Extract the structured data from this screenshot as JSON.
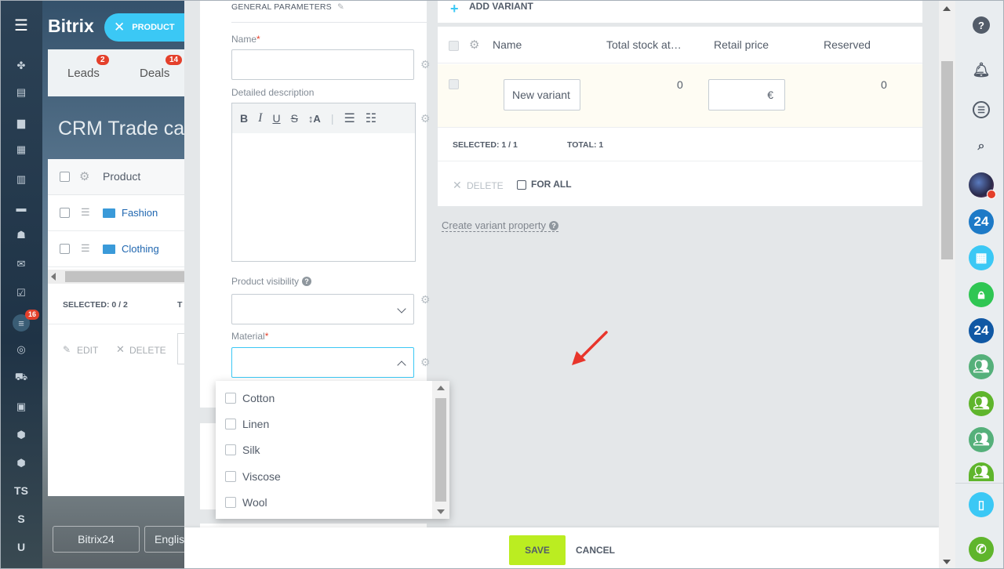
{
  "left_nav": {
    "badge_counter": "16",
    "text_items": [
      "TS",
      "S",
      "U"
    ]
  },
  "background_app": {
    "logo": "Bitrix",
    "tabs": [
      {
        "label": "Leads",
        "badge": "2"
      },
      {
        "label": "Deals",
        "badge": "14"
      }
    ],
    "page_title": "CRM Trade ca",
    "grid": {
      "header_label": "Product",
      "rows": [
        "Fashion",
        "Clothing"
      ],
      "selected_label": "SELECTED: 0 / 2",
      "trailing_text": "T",
      "edit_label": "EDIT",
      "delete_label": "DELETE"
    },
    "footer_logo": "Bitrix24",
    "footer_lang": "Englis"
  },
  "product_chip": {
    "label": "PRODUCT"
  },
  "form": {
    "section_title": "GENERAL PARAMETERS",
    "name_label": "Name",
    "description_label": "Detailed description",
    "visibility_label": "Product visibility",
    "material_label": "Material",
    "required_mark": "*",
    "toolbar": [
      "B",
      "I",
      "U",
      "S",
      "↕A"
    ],
    "material_options": [
      "Cotton",
      "Linen",
      "Silk",
      "Viscose",
      "Wool"
    ]
  },
  "variants": {
    "add_label": "ADD VARIANT",
    "columns": [
      "Name",
      "Total stock at…",
      "Retail price",
      "Reserved"
    ],
    "row": {
      "name_value": "New variant",
      "stock": "0",
      "currency": "€",
      "reserved": "0"
    },
    "selected": "SELECTED: 1 / 1",
    "total": "TOTAL: 1",
    "delete_label": "DELETE",
    "for_all_label": "FOR ALL",
    "create_property_link": "Create variant property"
  },
  "footer": {
    "save_label": "SAVE",
    "cancel_label": "CANCEL"
  },
  "right_bar": {
    "badge_24_a": "24",
    "badge_24_b": "24"
  },
  "colors": {
    "accent": "#3bc8f5",
    "save": "#bbed21",
    "badge": "#e4402b",
    "link": "#2067b0"
  }
}
